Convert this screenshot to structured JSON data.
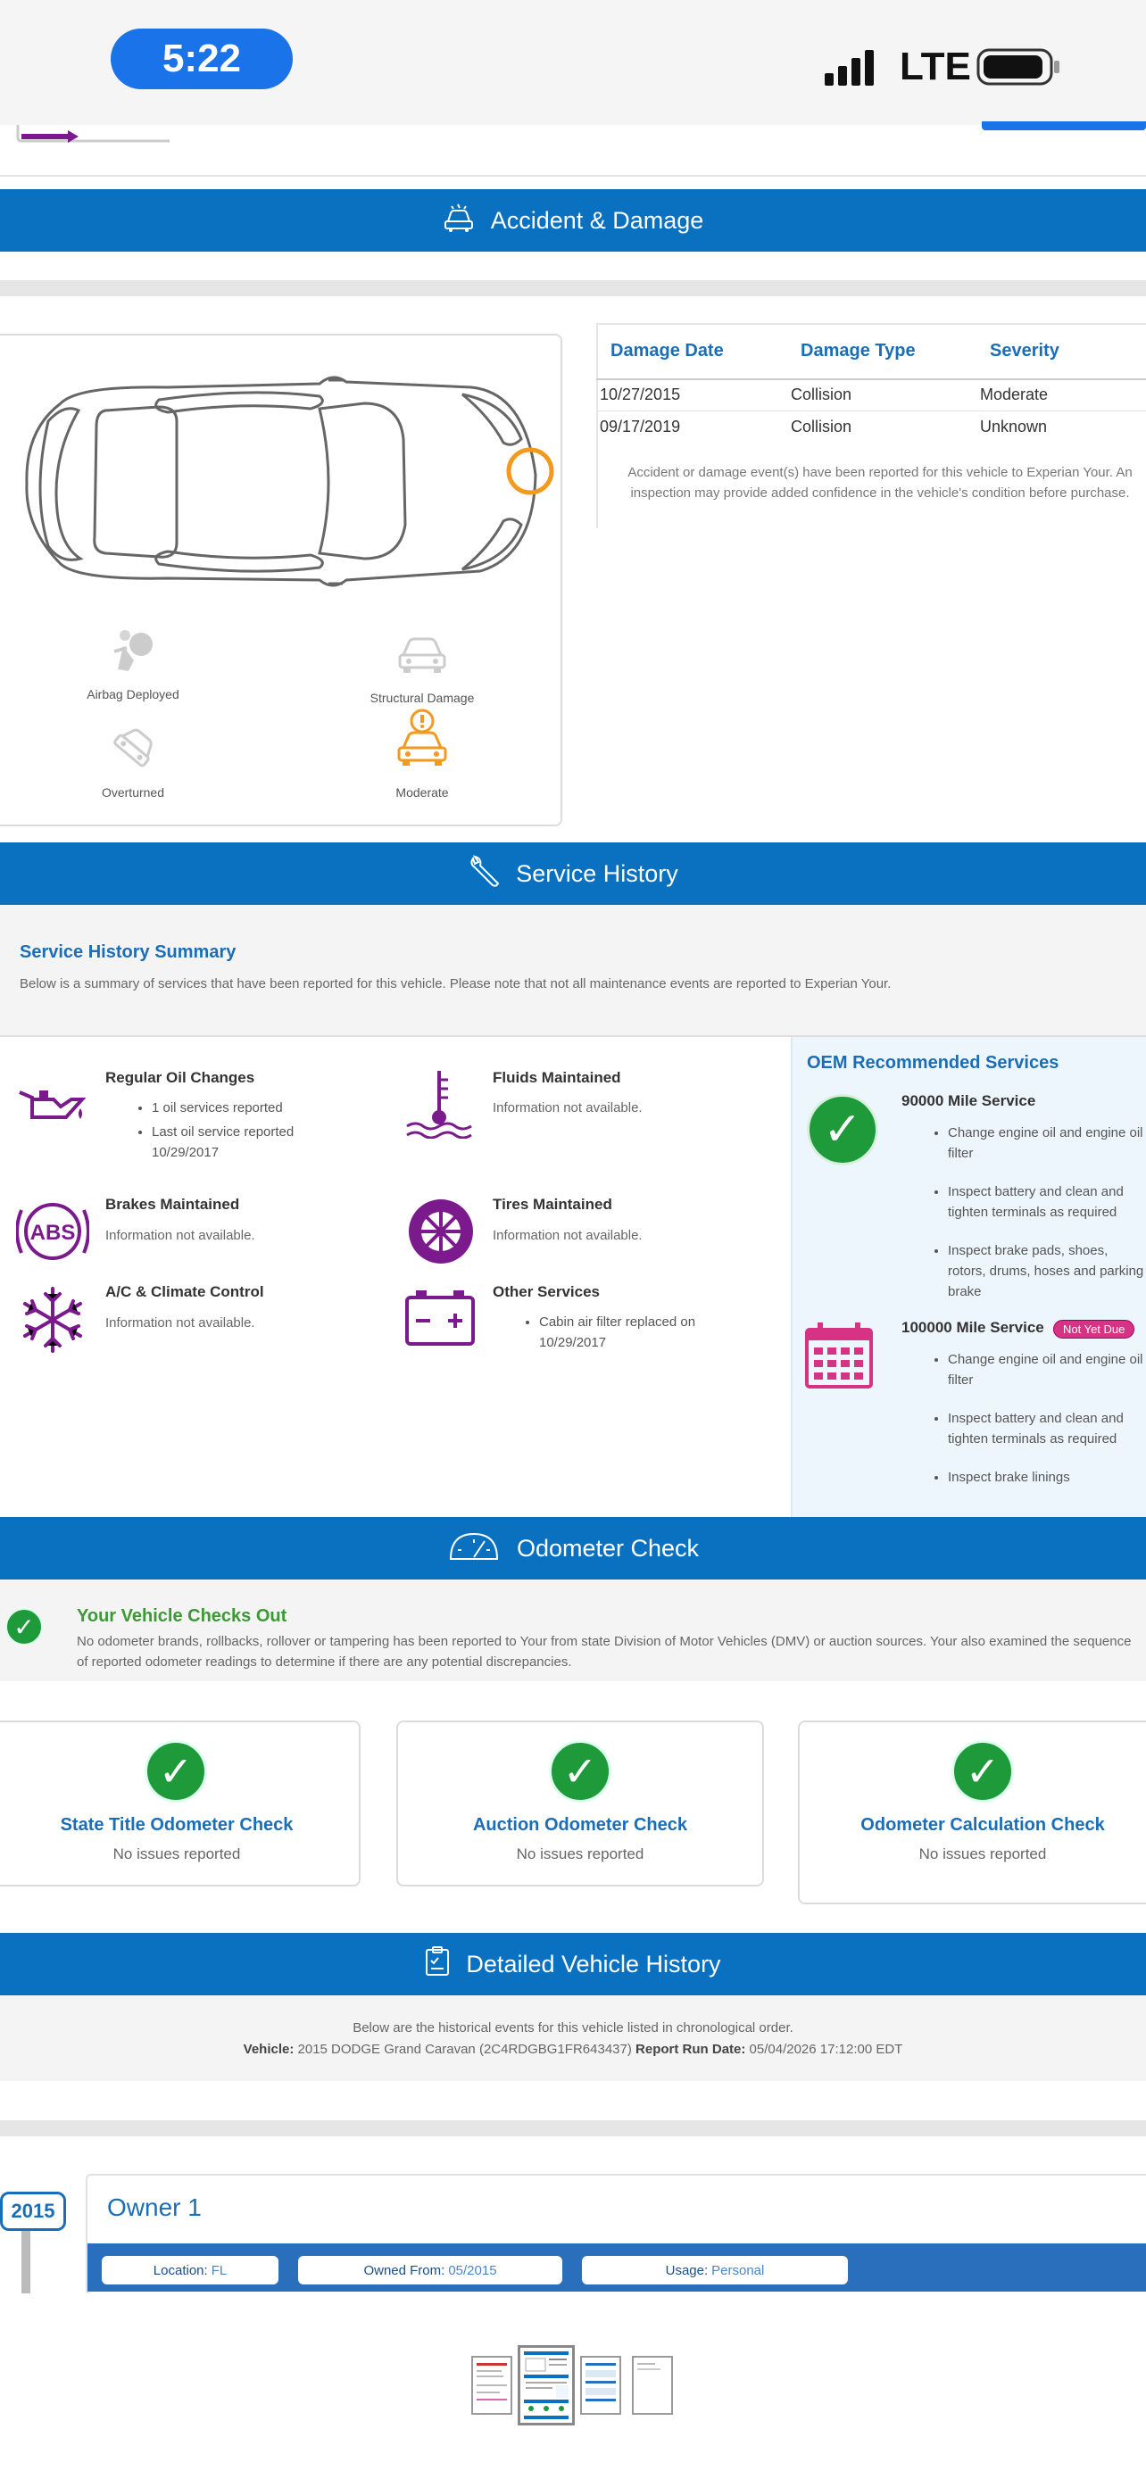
{
  "status_bar": {
    "time": "5:22",
    "network": "LTE"
  },
  "accident": {
    "title": "Accident & Damage",
    "headers": [
      "Damage Date",
      "Damage Type",
      "Severity"
    ],
    "rows": [
      [
        "10/27/2015",
        "Collision",
        "Moderate"
      ],
      [
        "09/17/2019",
        "Collision",
        "Unknown"
      ]
    ],
    "note": "Accident or damage event(s) have been reported for this vehicle to Experian Your. An inspection may provide added confidence in the vehicle's condition before purchase.",
    "icons": {
      "airbag": "Airbag Deployed",
      "structural": "Structural Damage",
      "overturned": "Overturned",
      "moderate": "Moderate"
    },
    "colors": {
      "impact": "#f39a1e"
    }
  },
  "service": {
    "title": "Service History",
    "summary_title": "Service History Summary",
    "summary_text": "Below is a summary of services that have been reported for this vehicle. Please note that not all maintenance events are reported to Experian Your.",
    "oil": {
      "title": "Regular Oil Changes",
      "b1": "1 oil services reported",
      "b2": "Last oil service reported 10/29/2017"
    },
    "fluids": {
      "title": "Fluids Maintained",
      "text": "Information not available."
    },
    "brakes": {
      "title": "Brakes Maintained",
      "text": "Information not available.",
      "abs": "ABS"
    },
    "tires": {
      "title": "Tires Maintained",
      "text": "Information not available."
    },
    "ac": {
      "title": "A/C & Climate Control",
      "text": "Information not available."
    },
    "other": {
      "title": "Other Services",
      "b1": "Cabin air filter replaced on 10/29/2017"
    },
    "oem": {
      "title": "OEM Recommended Services",
      "s1": {
        "title": "90000 Mile Service",
        "items": [
          "Change engine oil and engine oil filter",
          "Inspect battery and clean and tighten terminals as required",
          "Inspect brake pads, shoes, rotors, drums, hoses and parking brake"
        ]
      },
      "s2": {
        "title": "100000 Mile Service",
        "badge": "Not Yet Due",
        "items": [
          "Change engine oil and engine oil filter",
          "Inspect battery and clean and tighten terminals as required",
          "Inspect brake linings"
        ]
      }
    },
    "colors": {
      "purple": "#7b1a8c",
      "pink": "#d63384"
    }
  },
  "odometer": {
    "title": "Odometer Check",
    "ok_title": "Your Vehicle Checks Out",
    "ok_text": "No odometer brands, rollbacks, rollover or tampering has been reported to Your from state Division of Motor Vehicles (DMV) or auction sources. Your also examined the sequence of reported odometer readings to determine if there are any potential discrepancies.",
    "cards": [
      {
        "title": "State Title Odometer Check",
        "sub": "No issues reported"
      },
      {
        "title": "Auction Odometer Check",
        "sub": "No issues reported"
      },
      {
        "title": "Odometer Calculation Check",
        "sub": "No issues reported"
      }
    ]
  },
  "history": {
    "title": "Detailed Vehicle History",
    "intro": "Below are the historical events for this vehicle listed in chronological order.",
    "vehicle_label": "Vehicle:",
    "vehicle_value": "2015 DODGE Grand Caravan (2C4RDGBG1FR643437)",
    "run_label": "Report Run Date:",
    "run_value": "05/04/2026 17:12:00 EDT",
    "year": "2015",
    "owner": "Owner 1",
    "location_label": "Location:",
    "location_value": "FL",
    "owned_label": "Owned From:",
    "owned_value": "05/2015",
    "usage_label": "Usage:",
    "usage_value": "Personal"
  },
  "check_mark": "✓"
}
